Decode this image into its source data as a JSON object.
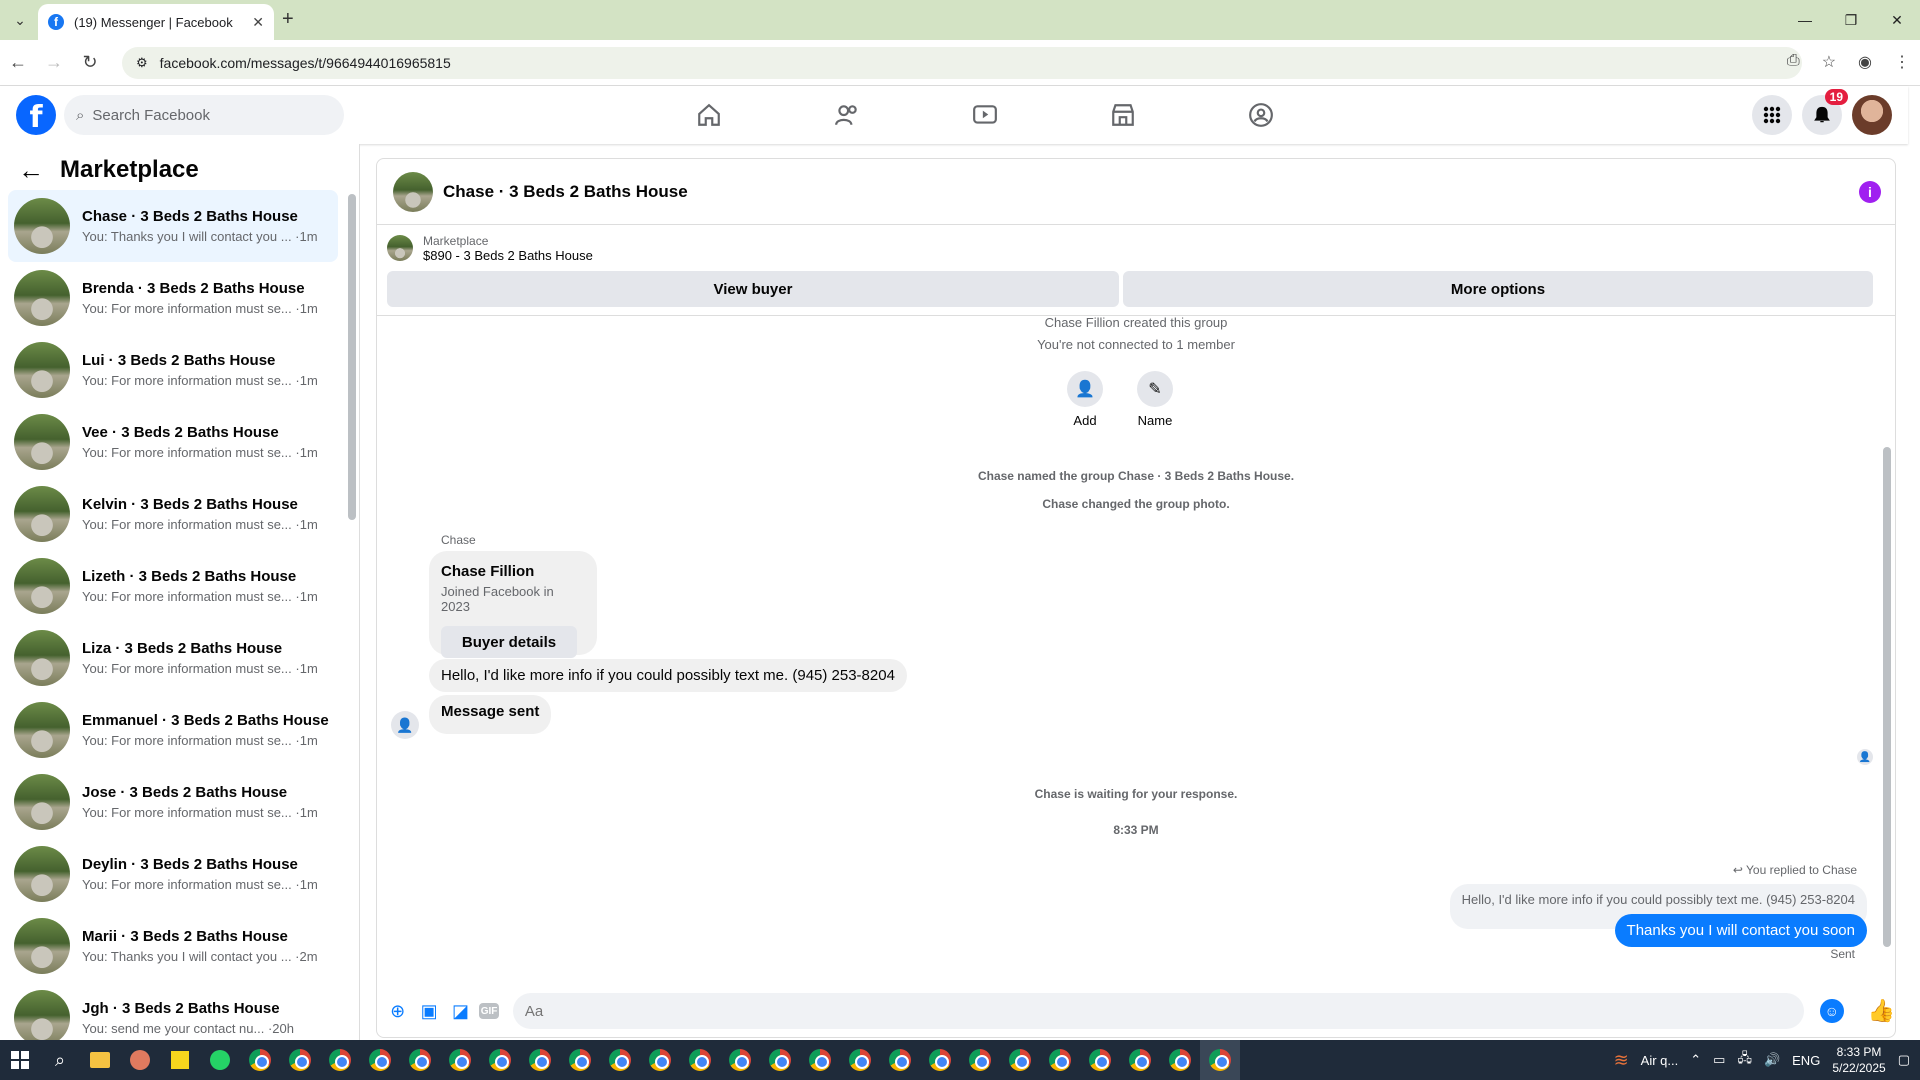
{
  "browser": {
    "tab_title": "(19) Messenger | Facebook",
    "url": "facebook.com/messages/t/9664944016965815"
  },
  "fb": {
    "search_placeholder": "Search Facebook",
    "notification_count": "19"
  },
  "left": {
    "title": "Marketplace",
    "conversations": [
      {
        "name": "Chase · 3 Beds 2 Baths House",
        "preview": "You: Thanks you I will contact you ... ·1m"
      },
      {
        "name": "Brenda · 3 Beds 2 Baths House",
        "preview": "You: For more information must se... ·1m"
      },
      {
        "name": "Lui · 3 Beds 2 Baths House",
        "preview": "You: For more information must se... ·1m"
      },
      {
        "name": "Vee · 3 Beds 2 Baths House",
        "preview": "You: For more information must se... ·1m"
      },
      {
        "name": "Kelvin · 3 Beds 2 Baths House",
        "preview": "You: For more information must se... ·1m"
      },
      {
        "name": "Lizeth · 3 Beds 2 Baths House",
        "preview": "You: For more information must se... ·1m"
      },
      {
        "name": "Liza · 3 Beds 2 Baths House",
        "preview": "You: For more information must se... ·1m"
      },
      {
        "name": "Emmanuel · 3 Beds 2 Baths House",
        "preview": "You: For more information must se... ·1m"
      },
      {
        "name": "Jose · 3 Beds 2 Baths House",
        "preview": "You: For more information must se... ·1m"
      },
      {
        "name": "Deylin · 3 Beds 2 Baths House",
        "preview": "You: For more information must se... ·1m"
      },
      {
        "name": "Marii · 3 Beds 2 Baths House",
        "preview": "You: Thanks you I will contact you ... ·2m"
      },
      {
        "name": "Jgh · 3 Beds 2 Baths House",
        "preview": "You: send me your contact nu... ·20h"
      }
    ]
  },
  "chat": {
    "title": "Chase · 3 Beds 2 Baths House",
    "marketplace_label": "Marketplace",
    "listing": "$890 - 3 Beds 2 Baths House",
    "view_buyer": "View buyer",
    "more_options": "More options",
    "created": "Chase Fillion created this group",
    "not_connected": "You're not connected to 1 member",
    "add_label": "Add",
    "name_label": "Name",
    "named_group": "Chase named the group Chase · 3 Beds 2 Baths House.",
    "changed_photo": "Chase changed the group photo.",
    "sender": "Chase",
    "buyer_name": "Chase Fillion",
    "buyer_joined": "Joined Facebook in 2023",
    "buyer_details": "Buyer details",
    "msg_in": "Hello, I'd like more info if you could possibly text me. (945) 253-8204",
    "msg_sent_note": "Message sent",
    "waiting": "Chase is waiting for your response.",
    "time": "8:33 PM",
    "replied_to": "You replied to Chase",
    "quoted": "Hello, I'd like more info if you could possibly text me. (945) 253-8204",
    "msg_out": "Thanks you I will contact you soon",
    "status": "Sent",
    "composer_placeholder": "Aa"
  },
  "taskbar": {
    "weather": "Air q...",
    "lang": "ENG",
    "time": "8:33 PM",
    "date": "5/22/2025"
  }
}
